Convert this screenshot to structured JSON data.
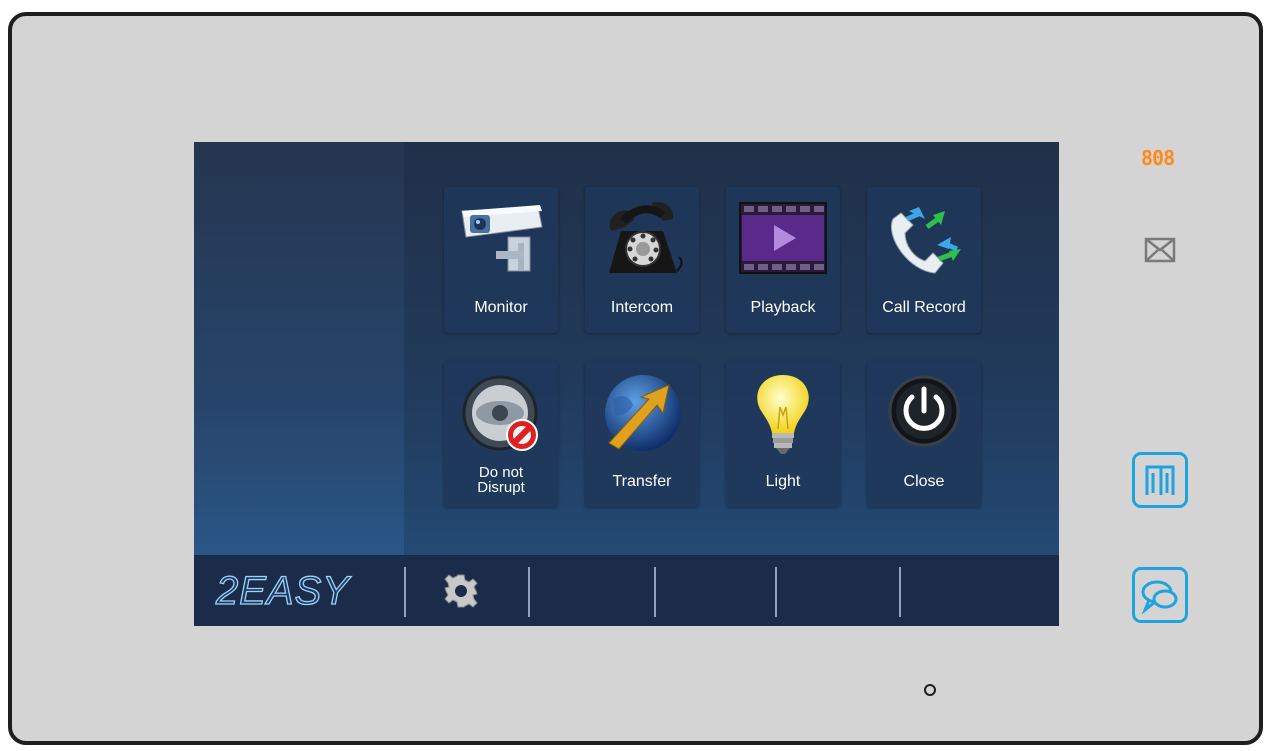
{
  "indicator": {
    "text": "808",
    "color": "#ff8a1a"
  },
  "menu": {
    "items": [
      {
        "label": "Monitor",
        "icon": "security-camera-icon"
      },
      {
        "label": "Intercom",
        "icon": "rotary-phone-icon"
      },
      {
        "label": "Playback",
        "icon": "video-play-icon"
      },
      {
        "label": "Call Record",
        "icon": "call-record-arrows-icon"
      },
      {
        "label": "Do not Disrupt",
        "icon": "do-not-disturb-icon"
      },
      {
        "label": "Transfer",
        "icon": "transfer-globe-icon"
      },
      {
        "label": "Light",
        "icon": "light-bulb-icon"
      },
      {
        "label": "Close",
        "icon": "power-icon"
      }
    ]
  },
  "bottombar": {
    "logo": "2EASY",
    "settings_icon": "gear-icon"
  },
  "side_buttons": [
    {
      "icon": "door-unlock-icon",
      "color": "#1fa3e0"
    },
    {
      "icon": "talk-icon",
      "color": "#1fa3e0"
    }
  ],
  "colors": {
    "accent": "#1fa3e0",
    "indicator": "#ff8a1a",
    "screen": "#27456b"
  }
}
